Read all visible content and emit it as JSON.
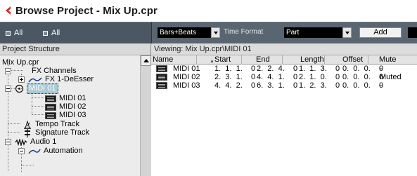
{
  "window": {
    "title": "Browse Project - Mix Up.cpr"
  },
  "left_toolbar": {
    "buttons": [
      "All",
      "All"
    ]
  },
  "right_toolbar": {
    "time_format_value": "Bars+Beats",
    "time_format_label": "Time Format",
    "type_value": "Part",
    "add_label": "Add"
  },
  "project_structure": {
    "header": "Project Structure",
    "items": [
      {
        "label": "Mix Up.cpr"
      },
      {
        "label": "FX Channels"
      },
      {
        "label": "FX 1-DeEsser"
      },
      {
        "label": "MIDI 01"
      },
      {
        "label": "MIDI 01"
      },
      {
        "label": "MIDI 02"
      },
      {
        "label": "MIDI 03"
      },
      {
        "label": "Tempo Track"
      },
      {
        "label": "Signature Track"
      },
      {
        "label": "Audio 1"
      },
      {
        "label": "Automation"
      }
    ]
  },
  "viewing": {
    "text": "Viewing: Mix Up.cpr\\MIDI 01"
  },
  "table": {
    "columns": [
      "Name",
      "Start",
      "End",
      "Length",
      "Offset",
      "Mute"
    ],
    "rows": [
      {
        "name": "MIDI 01",
        "start": "1.  1.  1.    0",
        "end": "2.  2.  4.    0",
        "length": "1.  1.  3.    0",
        "offset": "0.  0.  0.    0",
        "mute": "-"
      },
      {
        "name": "MIDI 02",
        "start": "2.  3.  1.    0",
        "end": "4.  4.  1.    0",
        "length": "2.  1.  0.    0",
        "offset": "0.  0.  0.    0",
        "mute": "Muted"
      },
      {
        "name": "MIDI 03",
        "start": "4.  4.  2.    0",
        "end": "6.  3.  1.    0",
        "length": "1.  2.  3.    0",
        "offset": "0.  0.  0.    0",
        "mute": "-"
      }
    ]
  },
  "icons": [
    "cubase-logo-icon",
    "all-square-icon",
    "dropdown-arrow-icon",
    "expand-icon",
    "collapse-icon",
    "midi-part-icon",
    "fx-icon",
    "midi-track-icon",
    "tempo-icon",
    "signature-icon",
    "audio-track-icon",
    "automation-icon",
    "scroll-up-icon"
  ],
  "colors": {
    "toolbar": "#4b5762",
    "selection": "#a9c9d3",
    "logo": "#d8262b"
  }
}
